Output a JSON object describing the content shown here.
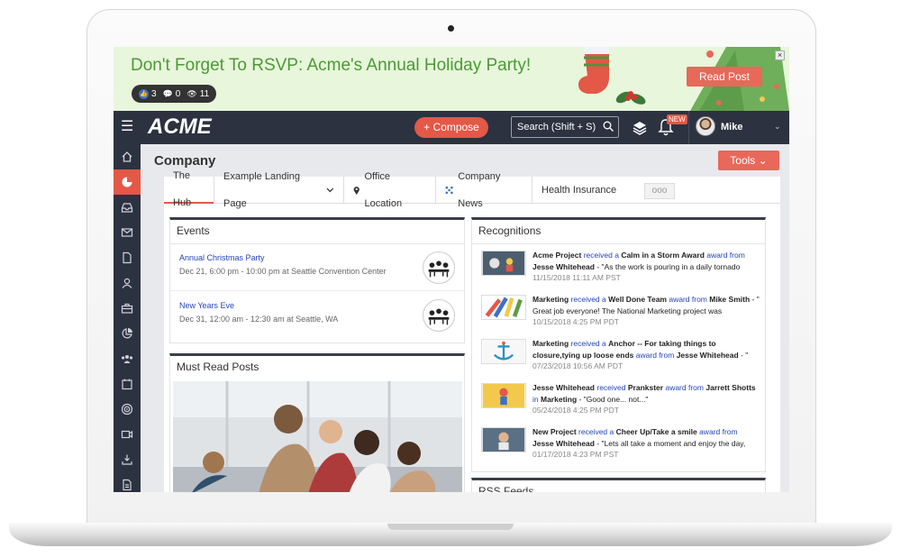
{
  "banner": {
    "title": "Don't Forget To RSVP: Acme's Annual Holiday Party!",
    "likes": "3",
    "comments": "0",
    "views": "11",
    "read_post_label": "Read Post",
    "close_label": "×"
  },
  "navbar": {
    "logo": "ACME",
    "compose_label": "+ Compose",
    "search_placeholder": "Search (Shift + S)",
    "new_badge": "NEW",
    "user_name": "Mike"
  },
  "page": {
    "title": "Company",
    "tools_label": "Tools"
  },
  "tabs": [
    {
      "label": "The Hub",
      "icon": ""
    },
    {
      "label": "Example Landing Page",
      "icon": "chevron-down-icon"
    },
    {
      "label": "Office Location",
      "icon": "map-pin-icon"
    },
    {
      "label": "Company News",
      "icon": "network-icon"
    },
    {
      "label": "Health Insurance",
      "icon": ""
    }
  ],
  "tab_more_label": "ooo",
  "events_panel": {
    "title": "Events",
    "items": [
      {
        "title": "Annual Christmas Party",
        "meta": "Dec 21, 6:00 pm - 10:00 pm at Seattle Convention Center"
      },
      {
        "title": "New Years Eve",
        "meta": "Dec 31, 12:00 am - 12:30 am at Seattle, WA"
      }
    ]
  },
  "must_read": {
    "title": "Must Read Posts"
  },
  "recognitions": {
    "title": "Recognitions",
    "items": [
      {
        "recipient": "Acme Project",
        "received": "received a",
        "award": "Calm in a Storm Award",
        "award_from": "award from",
        "giver": "Jesse Whitehead",
        "message": "- \"As the work is pouring in a daily tornado",
        "date": "11/15/2018 11:11 AM PST"
      },
      {
        "recipient": "Marketing",
        "received": "received a",
        "award": "Well Done Team",
        "award_from": "award from",
        "giver": "Mike Smith",
        "message": "- \" Great job everyone! The National Marketing project was",
        "date": "10/15/2018 4:25 PM PDT"
      },
      {
        "recipient": "Marketing",
        "received": "received a",
        "award": "Anchor -- For taking things to closure,tying up loose ends",
        "award_from": "award from",
        "giver": "Jesse Whitehead",
        "message": "- \"",
        "date": "07/23/2018 10:56 AM PDT"
      },
      {
        "recipient": "Jesse Whitehead",
        "received": "received",
        "award": "Prankster",
        "award_from": "award from",
        "giver": "Jarrett Shotts",
        "in_label": "in",
        "team": "Marketing",
        "message": "- \"Good one... not...\"",
        "date": "05/24/2018 4:25 PM PDT"
      },
      {
        "recipient": "New Project",
        "received": "received a",
        "award": "Cheer Up/Take a smile",
        "award_from": "award from",
        "giver": "Jesse Whitehead",
        "message": "- \"Lets all take a moment and enjoy the day,",
        "date": "01/17/2018 4:23 PM PST"
      }
    ]
  },
  "rss": {
    "title": "RSS Feeds"
  },
  "sidebar": {
    "icons": [
      "home-icon",
      "pie-chart-icon",
      "inbox-icon",
      "mail-icon",
      "document-icon",
      "user-icon",
      "briefcase-icon",
      "chart-icon",
      "people-icon",
      "calendar-icon",
      "target-icon",
      "video-icon",
      "download-icon",
      "file-icon"
    ],
    "active_index": 1
  },
  "colors": {
    "accent": "#e35847",
    "navbar": "#2c3240",
    "banner_bg": "#e8f6dc",
    "banner_text": "#4b9a34",
    "link": "#2445b4"
  }
}
